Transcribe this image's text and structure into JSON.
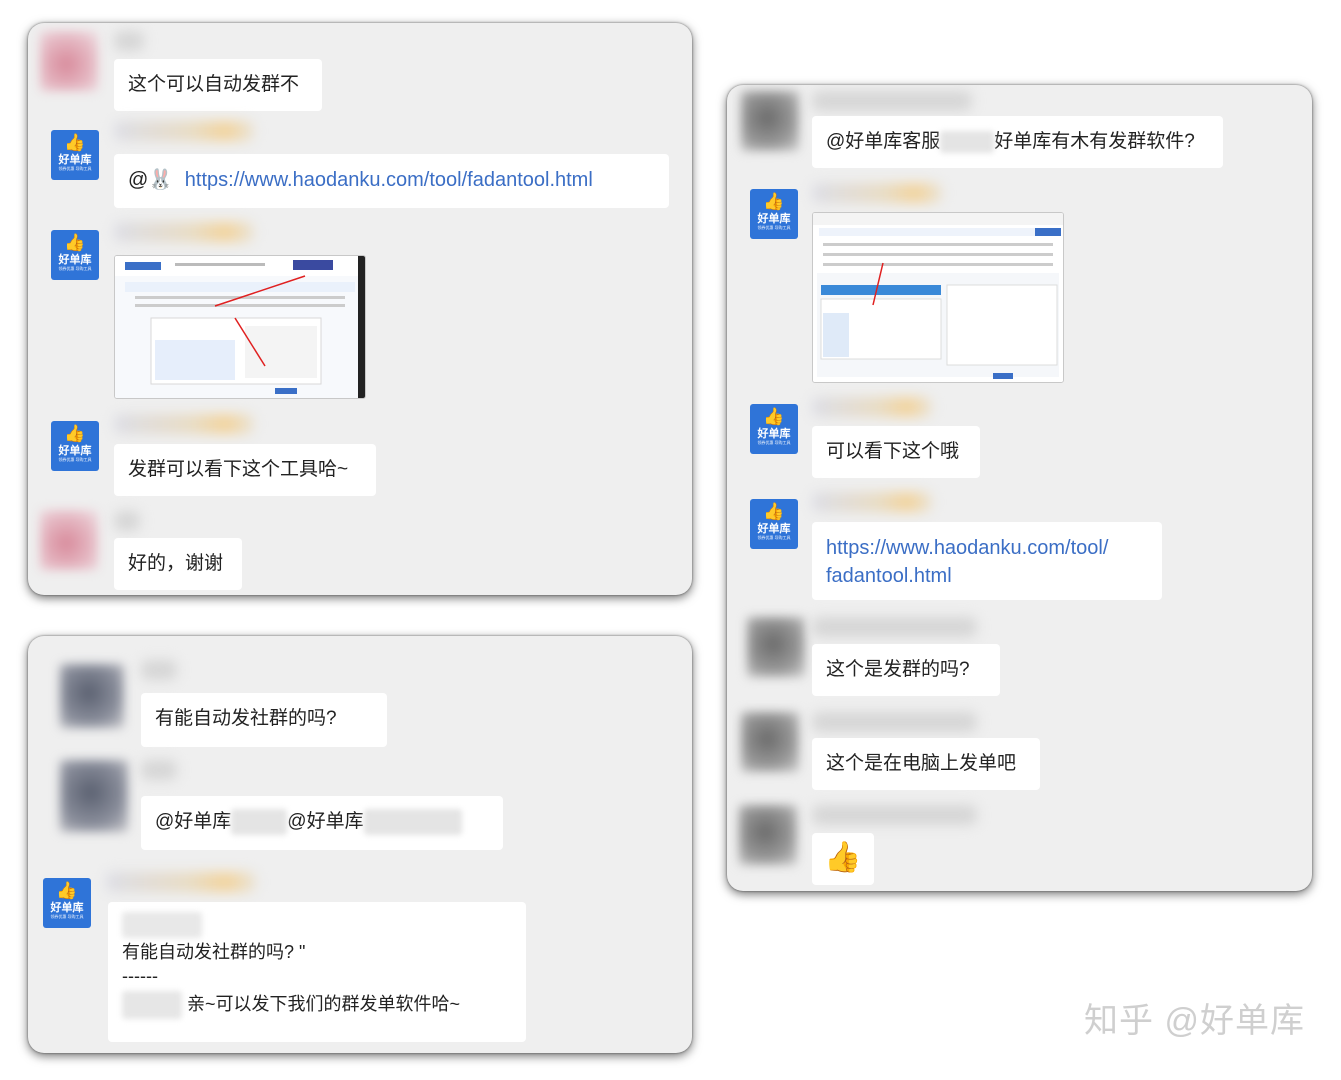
{
  "panel1": {
    "msg1": "这个可以自动发群不",
    "msg2_prefix": "@🐰",
    "msg2_link": "https://www.haodanku.com/tool/fadantool.html",
    "msg4": "发群可以看下这个工具哈~",
    "msg5": "好的，谢谢"
  },
  "panel2": {
    "msg1_prefix": "@好单库客服",
    "msg1_suffix": "好单库有木有发群软件?",
    "msg3": "可以看下这个哦",
    "msg4_link_line1": "https://www.haodanku.com/tool/",
    "msg4_link_line2": "fadantool.html",
    "msg5": "这个是发群的吗?",
    "msg6": "这个是在电脑上发单吧",
    "msg7_emoji": "👍"
  },
  "panel3": {
    "msg1": "有能自动发社群的吗?",
    "msg2_at1": "@好单库",
    "msg2_at2": "@好单库",
    "quote_text": "有能自动发社群的吗? \"",
    "quote_divider": "------",
    "reply_text": "亲~可以发下我们的群发单软件哈~"
  },
  "logo": {
    "brand": "好单库",
    "hand": "👍",
    "tiny": "领券优惠 导购工具"
  },
  "watermark": "知乎 @好单库",
  "colors": {
    "panel_bg": "#efefef",
    "link": "#3b6ec5",
    "logo_bg": "#2f74d8"
  }
}
